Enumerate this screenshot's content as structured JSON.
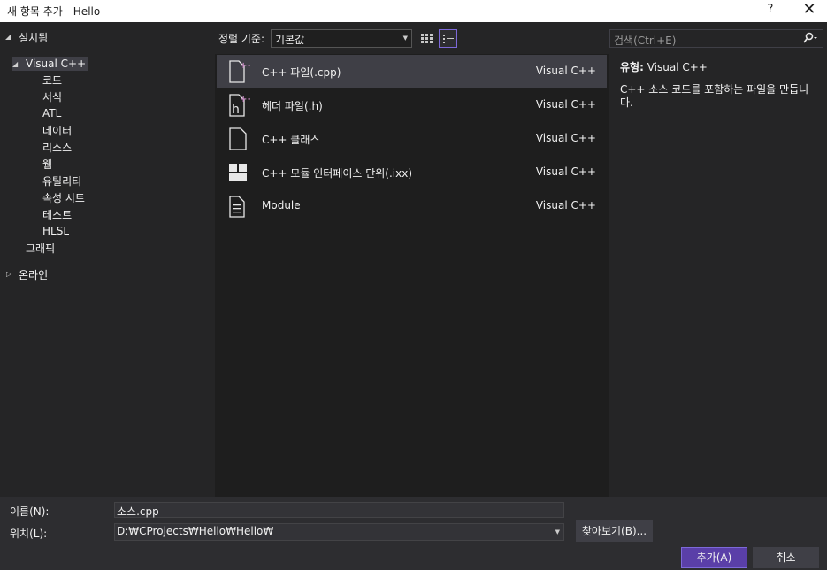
{
  "window": {
    "title": "새 항목 추가 - Hello",
    "help": "?",
    "close": "✕"
  },
  "tree": {
    "installed": "설치됨",
    "visual_cpp": "Visual C++",
    "children": [
      "코드",
      "서식",
      "ATL",
      "데이터",
      "리소스",
      "웹",
      "유틸리티",
      "속성 시트",
      "테스트",
      "HLSL"
    ],
    "graphics": "그래픽",
    "online": "온라인"
  },
  "toolbar": {
    "sort_label": "정렬 기준:",
    "sort_value": "기본값"
  },
  "search": {
    "placeholder": "검색(Ctrl+E)"
  },
  "templates": [
    {
      "name": "C++ 파일(.cpp)",
      "lang": "Visual C++",
      "icon": "cpp-file-icon"
    },
    {
      "name": "헤더 파일(.h)",
      "lang": "Visual C++",
      "icon": "header-file-icon"
    },
    {
      "name": "C++ 클래스",
      "lang": "Visual C++",
      "icon": "class-file-icon"
    },
    {
      "name": "C++ 모듈 인터페이스 단위(.ixx)",
      "lang": "Visual C++",
      "icon": "module-interface-icon"
    },
    {
      "name": "Module",
      "lang": "Visual C++",
      "icon": "module-icon"
    }
  ],
  "details": {
    "type_label": "유형:",
    "type_value": "Visual C++",
    "description": "C++ 소스 코드를 포함하는 파일을 만듭니다."
  },
  "form": {
    "name_label": "이름(N):",
    "name_value": "소스.cpp",
    "location_label": "위치(L):",
    "location_value": "D:₩CProjects₩Hello₩Hello₩",
    "browse": "찾아보기(B)...",
    "add": "추가(A)",
    "cancel": "취소"
  },
  "colors": {
    "accent": "#7d69d9",
    "primary_button": "#5a3fa8",
    "selected_row": "#3f3f46"
  }
}
